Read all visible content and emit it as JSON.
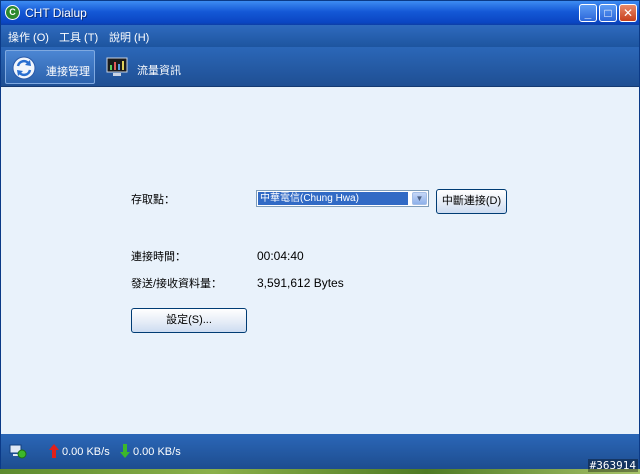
{
  "window": {
    "title": "CHT Dialup",
    "minimize_glyph": "_",
    "maximize_glyph": "□",
    "close_glyph": "✕"
  },
  "menu": {
    "items": [
      {
        "label": "操作 (O)"
      },
      {
        "label": "工具 (T)"
      },
      {
        "label": "說明 (H)"
      }
    ]
  },
  "toolbar": {
    "connection_label": "連接管理",
    "traffic_label": "流量資訊"
  },
  "main": {
    "access_point_label": "存取點：",
    "access_point_value": "中華電信(Chung Hwa)",
    "disconnect_button": "中斷連接(D)",
    "connect_time_label": "連接時間：",
    "connect_time_value": "00:04:40",
    "data_label": "發送/接收資料量：",
    "data_value": "3,591,612 Bytes",
    "settings_button": "設定(S)..."
  },
  "status": {
    "upload": "0.00 KB/s",
    "download": "0.00 KB/s"
  },
  "watermark": "#363914",
  "colors": {
    "titlebar": "#1458d6",
    "toolbar": "#2b67b8",
    "content": "#e9f2fb",
    "upload_arrow": "#e0201a",
    "download_arrow": "#3cb82a"
  }
}
